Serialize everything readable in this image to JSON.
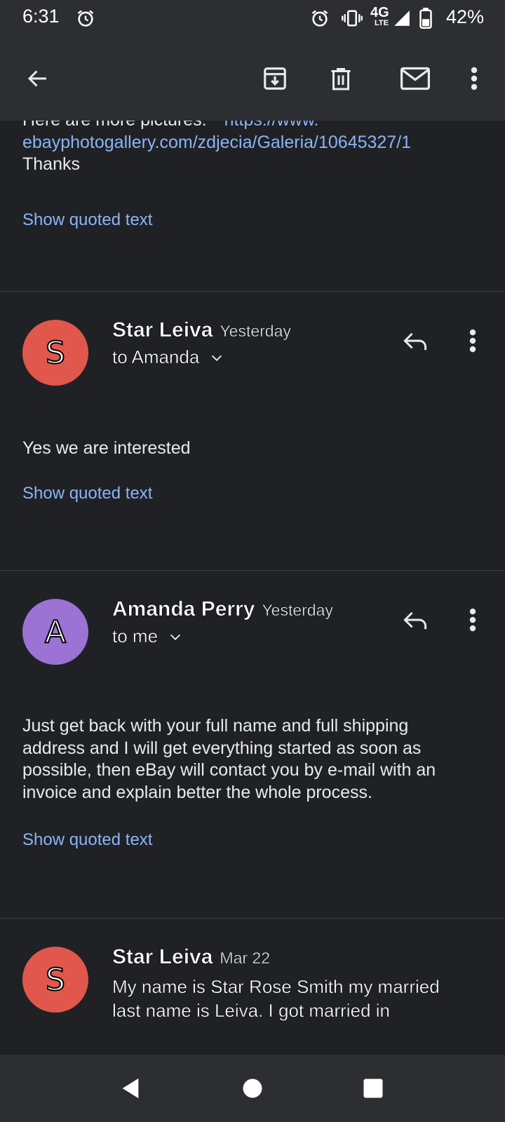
{
  "status_bar": {
    "time": "6:31",
    "network": "4G",
    "network_sub": "LTE",
    "battery": "42%"
  },
  "icons": {
    "back": "arrow-left-icon",
    "archive": "archive-icon",
    "delete": "trash-icon",
    "mark_unread": "mail-icon",
    "more": "more-vert-icon",
    "reply": "reply-icon",
    "expand": "chevron-down-icon"
  },
  "colors": {
    "background": "#202124",
    "link": "#8ab4f8",
    "avatar_s": "#e2574c",
    "avatar_a": "#9a73d4"
  },
  "thread": {
    "top_fragment": {
      "line1": "Here are more pictures:",
      "link_part1": "https://www.",
      "link_part2": "ebayphotogallery.com/zdjecia/Galeria/10645327/1",
      "line3": "Thanks",
      "show_quoted": "Show quoted text"
    },
    "messages": [
      {
        "avatar_letter": "S",
        "sender": "Star Leiva",
        "date": "Yesterday",
        "recipient": "to Amanda",
        "body": "Yes we are interested",
        "show_quoted": "Show quoted text"
      },
      {
        "avatar_letter": "A",
        "sender": "Amanda Perry",
        "date": "Yesterday",
        "recipient": "to me",
        "body_lines": [
          "Just get back with your full name and full shipping",
          "address and I will get everything started as soon as",
          "possible, then eBay will contact you by e-mail with an",
          "invoice and explain better the whole process."
        ],
        "show_quoted": "Show quoted text"
      },
      {
        "avatar_letter": "S",
        "sender": "Star Leiva",
        "date": "Mar 22",
        "preview_lines": [
          "My name is Star Rose Smith my married",
          "last name is Leiva. I got married in"
        ]
      }
    ]
  }
}
